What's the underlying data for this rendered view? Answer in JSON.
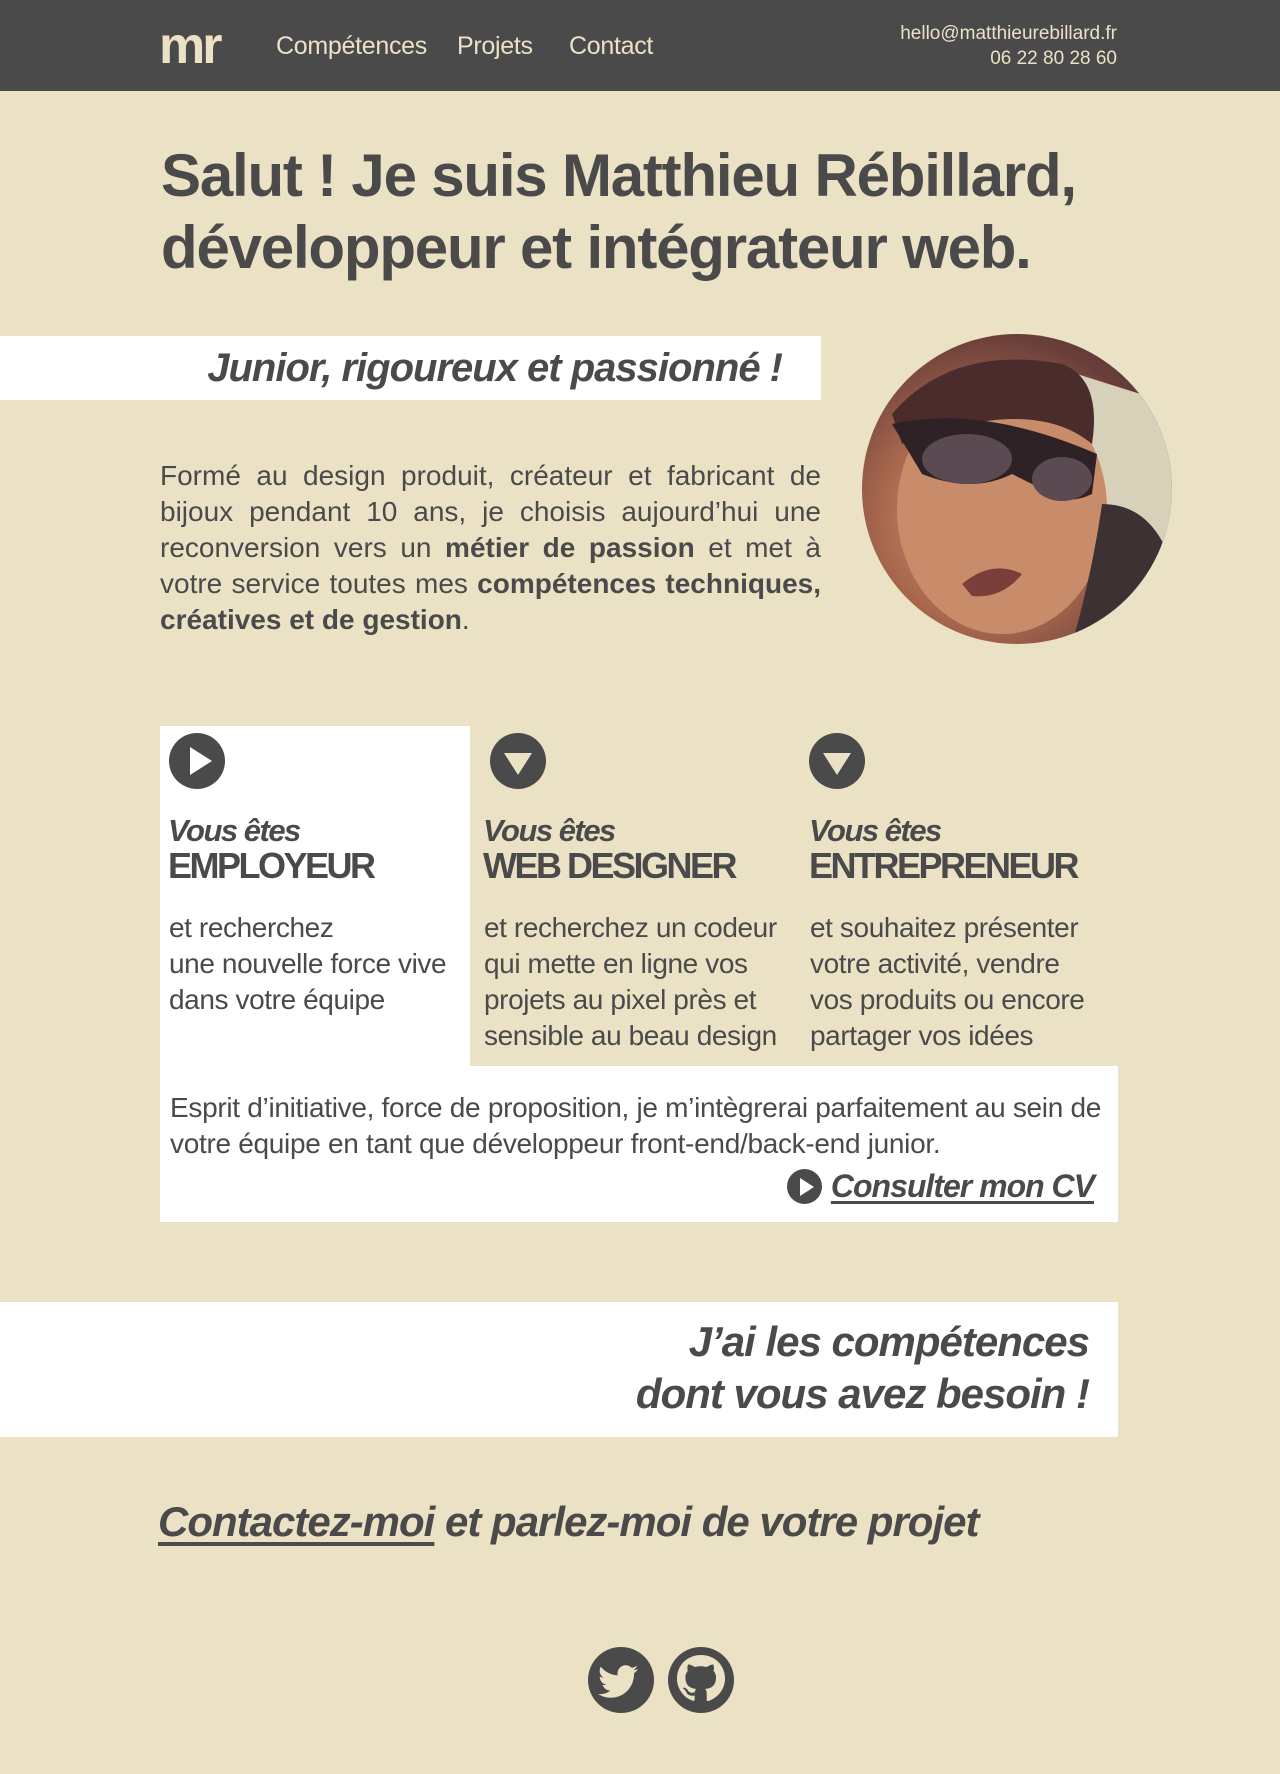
{
  "header": {
    "logo": "mr",
    "nav": [
      "Compétences",
      "Projets",
      "Contact"
    ],
    "email": "hello@matthieurebillard.fr",
    "phone": "06 22 80 28 60"
  },
  "hero": {
    "title_line1": "Salut ! Je suis Matthieu Rébillard,",
    "title_line2": "développeur et intégrateur web.",
    "tagline": "Junior, rigoureux et passionné !",
    "intro": {
      "t1": "Formé au design produit, créateur et fabricant de bijoux pendant 10 ans, je choisis aujourd’hui une reconversion vers un ",
      "b1": "métier de passion",
      "t2": " et met à votre service toutes mes ",
      "b2": "compétences techniques, créatives et de gestion",
      "t3": "."
    }
  },
  "profiles": [
    {
      "you_are": "Vous êtes",
      "role": "EMPLOYEUR",
      "desc": "et recherchez\nune nouvelle force vive\ndans votre équipe",
      "icon": "play-right-icon",
      "active": true
    },
    {
      "you_are": "Vous êtes",
      "role": "WEB DESIGNER",
      "desc": "et recherchez un codeur\nqui mette en ligne vos\nprojets au pixel près et\nsensible au beau design",
      "icon": "chevron-down-icon",
      "active": false
    },
    {
      "you_are": "Vous êtes",
      "role": "ENTREPRENEUR",
      "desc": "et souhaitez présenter\nvotre activité, vendre\nvos produits ou encore\npartager vos idées",
      "icon": "chevron-down-icon",
      "active": false
    }
  ],
  "employer_panel": {
    "text": "Esprit d’initiative, force de proposition, je m’intègrerai parfaitement au sein de votre équipe en tant que développeur front-end/back-end junior.",
    "cv_link": "Consulter mon CV"
  },
  "skills": {
    "title": "J’ai les compétences\ndont vous avez besoin !"
  },
  "cta": {
    "link": "Contactez-moi",
    "rest": " et parlez-moi de votre projet"
  },
  "social": [
    "twitter-icon",
    "github-icon"
  ],
  "colors": {
    "background": "#ebe2c6",
    "header": "#4a4a4a",
    "text": "#4a4a4a",
    "panel": "#ffffff"
  }
}
